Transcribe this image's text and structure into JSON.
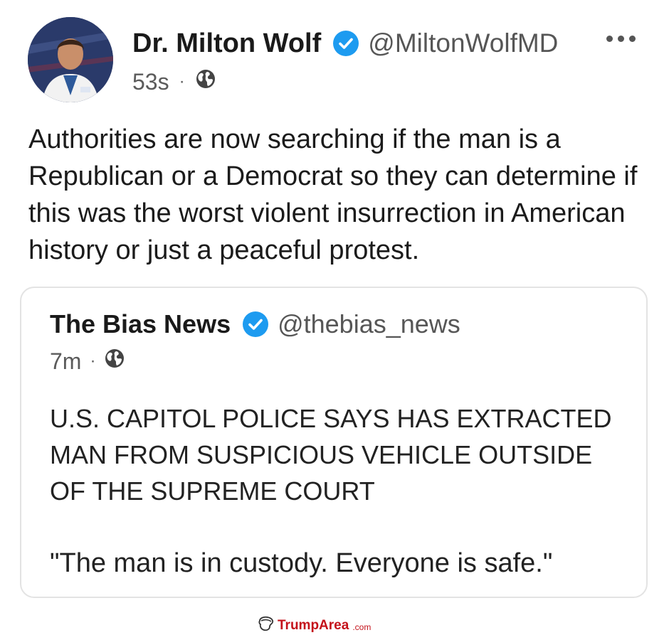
{
  "post": {
    "author_name": "Dr. Milton Wolf",
    "handle": "@MiltonWolfMD",
    "time": "53s",
    "separator": "·",
    "text": "Authorities are now searching if the man is a Republican or a Democrat so they can determine if this was the worst violent insurrection in American history or just a peaceful protest.",
    "icons": {
      "verified": "verified-badge-icon",
      "visibility": "globe-icon",
      "menu": "more-options-icon",
      "avatar": "avatar"
    }
  },
  "quote": {
    "author_name": "The Bias News",
    "handle": "@thebias_news",
    "time": "7m",
    "separator": "·",
    "text": "U.S. CAPITOL POLICE SAYS HAS EXTRACTED MAN FROM SUSPICIOUS VEHICLE OUTSIDE OF THE SUPREME COURT",
    "text2": "\"The man is in custody. Everyone is safe.\""
  },
  "watermark": {
    "brand": "TrumpArea",
    "suffix": ".com"
  },
  "colors": {
    "verified": "#1d9bf0",
    "text": "#1a1a1a",
    "muted": "#5b5b5b",
    "border": "#e3e3e3",
    "watermark": "#c4121a"
  }
}
